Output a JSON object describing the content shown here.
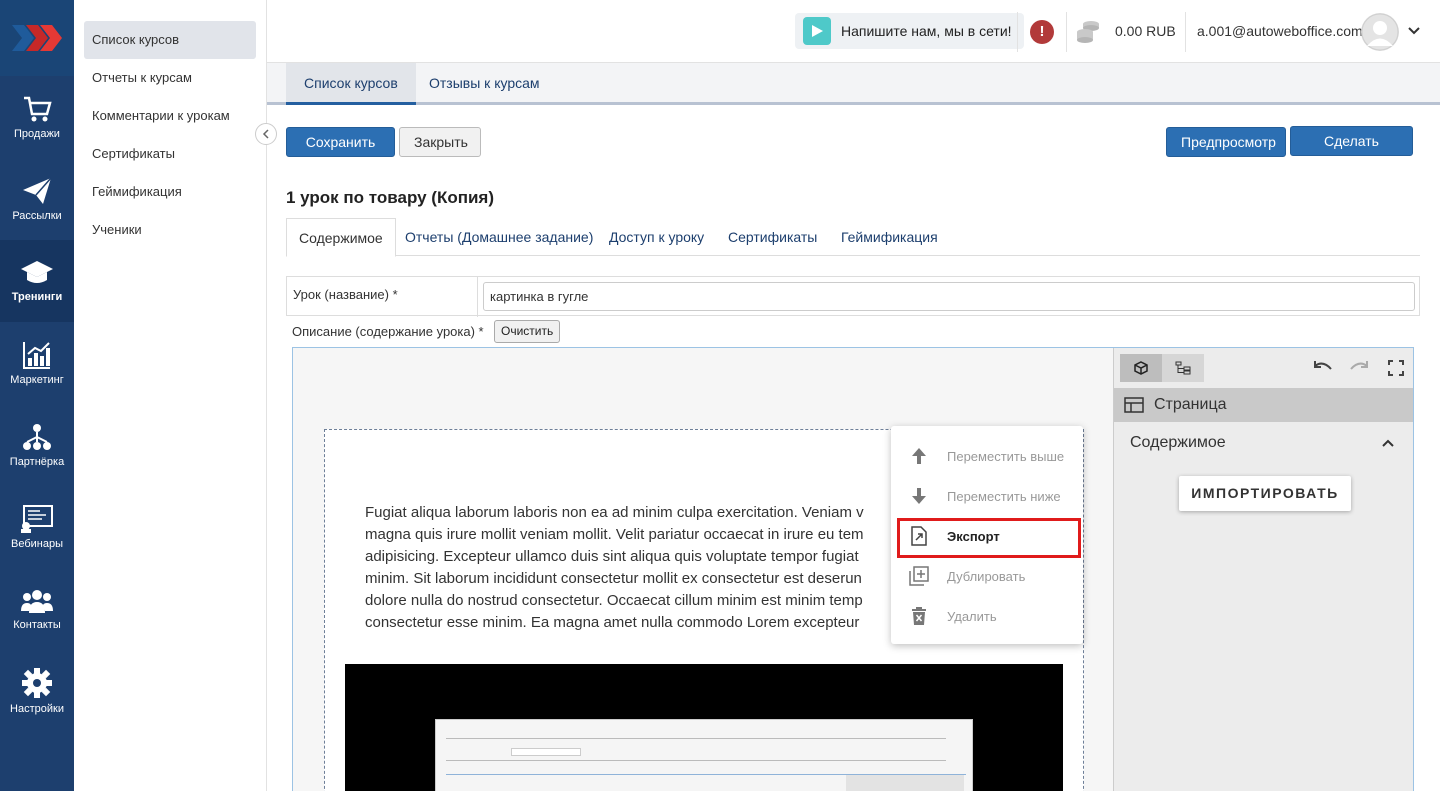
{
  "rail": {
    "items": [
      {
        "label": "Продажи",
        "icon": "cart-icon"
      },
      {
        "label": "Рассылки",
        "icon": "paper-plane-icon"
      },
      {
        "label": "Тренинги",
        "icon": "graduation-cap-icon",
        "active": true
      },
      {
        "label": "Маркетинг",
        "icon": "bar-chart-icon"
      },
      {
        "label": "Партнёрка",
        "icon": "network-icon"
      },
      {
        "label": "Вебинары",
        "icon": "webinar-screen-icon"
      },
      {
        "label": "Контакты",
        "icon": "users-icon"
      },
      {
        "label": "Настройки",
        "icon": "gear-icon"
      }
    ]
  },
  "subnav": {
    "items": [
      {
        "label": "Список курсов",
        "active": true
      },
      {
        "label": "Отчеты к курсам"
      },
      {
        "label": "Комментарии к урокам"
      },
      {
        "label": "Сертификаты"
      },
      {
        "label": "Геймификация"
      },
      {
        "label": "Ученики"
      }
    ]
  },
  "header": {
    "chat_label": "Напишите нам, мы в сети!",
    "alert_symbol": "!",
    "balance": "0.00 RUB",
    "email": "a.001@autoweboffice.com"
  },
  "page_tabs": [
    "Список курсов",
    "Отзывы к курсам"
  ],
  "actions": {
    "save": "Сохранить",
    "close": "Закрыть",
    "preview": "Предпросмотр",
    "copy": "Сделать копию"
  },
  "lesson_title": "1 урок по товару (Копия)",
  "inner_tabs": [
    "Содержимое",
    "Отчеты (Домашнее задание)",
    "Доступ к уроку",
    "Сертификаты",
    "Геймификация"
  ],
  "form": {
    "name_label": "Урок (название) *",
    "name_value": "картинка в гугле",
    "desc_label": "Описание (содержание урока) *",
    "clear_label": "Очистить"
  },
  "editor": {
    "text_lines": [
      "Fugiat aliqua laborum laboris non ea ad minim culpa exercitation. Veniam v",
      "magna quis irure mollit veniam mollit. Velit pariatur occaecat in irure eu tem",
      "adipisicing. Excepteur ullamco duis sint aliqua quis voluptate tempor fugiat",
      "minim. Sit laborum incididunt consectetur mollit ex consectetur est deserun",
      "dolore nulla do nostrud consectetur. Occaecat cillum minim est minim temp",
      "consectetur esse minim. Ea magna amet nulla commodo Lorem excepteur"
    ],
    "context_menu": [
      {
        "label": "Переместить выше",
        "icon": "arrow-up-icon"
      },
      {
        "label": "Переместить ниже",
        "icon": "arrow-down-icon"
      },
      {
        "label": "Экспорт",
        "icon": "export-file-icon",
        "highlighted": true
      },
      {
        "label": "Дублировать",
        "icon": "duplicate-icon"
      },
      {
        "label": "Удалить",
        "icon": "trash-icon"
      }
    ],
    "panel": {
      "page_label": "Страница",
      "section_label": "Содержимое",
      "import_label": "ИМПОРТИРОВАТЬ"
    }
  }
}
